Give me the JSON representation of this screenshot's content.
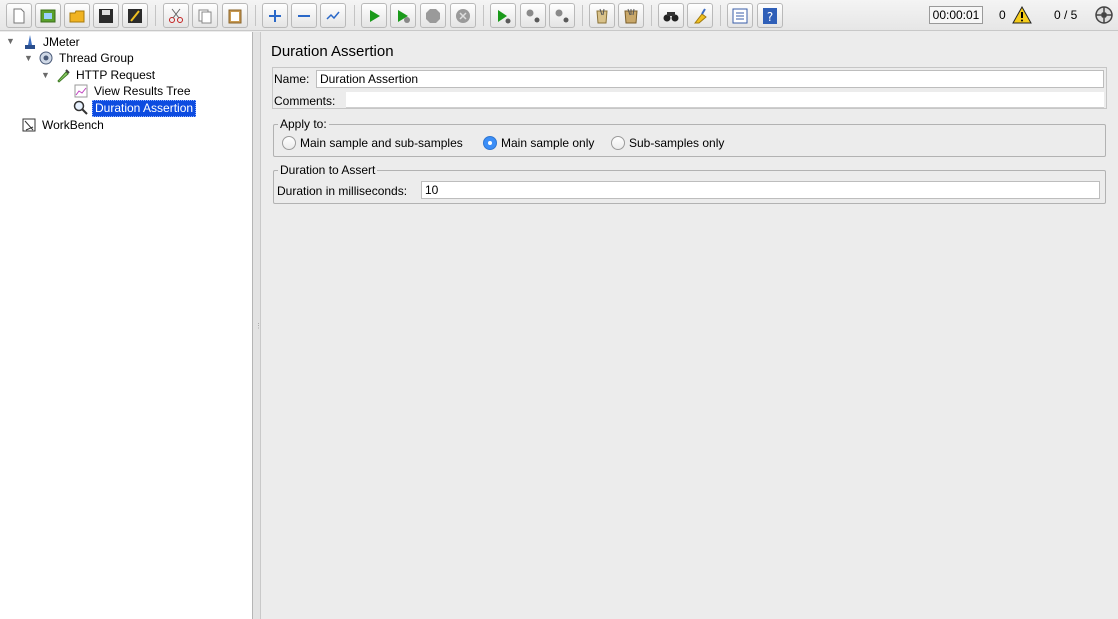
{
  "toolbar": {
    "buttons": [
      {
        "name": "new-icon"
      },
      {
        "name": "templates-icon"
      },
      {
        "name": "open-icon"
      },
      {
        "name": "save-icon"
      },
      {
        "name": "save-as-icon"
      },
      {
        "name": "cut-icon"
      },
      {
        "name": "copy-icon"
      },
      {
        "name": "paste-icon"
      },
      {
        "name": "expand-icon"
      },
      {
        "name": "collapse-icon"
      },
      {
        "name": "toggle-icon"
      },
      {
        "name": "start-icon"
      },
      {
        "name": "start-no-pause-icon"
      },
      {
        "name": "stop-icon"
      },
      {
        "name": "shutdown-icon"
      },
      {
        "name": "remote-start-icon"
      },
      {
        "name": "remote-stop-icon"
      },
      {
        "name": "remote-shutdown-icon"
      },
      {
        "name": "clear-icon"
      },
      {
        "name": "clear-all-icon"
      },
      {
        "name": "search-icon"
      },
      {
        "name": "reset-search-icon"
      },
      {
        "name": "function-helper-icon"
      },
      {
        "name": "help-icon"
      }
    ],
    "timer": "00:00:01",
    "error_count": "0",
    "thread_count": "0 / 5"
  },
  "tree": {
    "nodes": [
      {
        "label": "JMeter",
        "icon": "jmeter-icon"
      },
      {
        "label": "Thread Group",
        "icon": "gear-icon"
      },
      {
        "label": "HTTP Request",
        "icon": "pipette-icon"
      },
      {
        "label": "View Results Tree",
        "icon": "chart-icon"
      },
      {
        "label": "Duration Assertion",
        "icon": "magnifier-icon",
        "selected": true
      },
      {
        "label": "WorkBench",
        "icon": "workbench-icon"
      }
    ]
  },
  "panel": {
    "title": "Duration Assertion",
    "name_label": "Name:",
    "name_value": "Duration Assertion",
    "comments_label": "Comments:",
    "comments_value": "",
    "apply_to": {
      "legend": "Apply to:",
      "options": [
        "Main sample and sub-samples",
        "Main sample only",
        "Sub-samples only"
      ],
      "selected": "Main sample only"
    },
    "duration": {
      "legend": "Duration to Assert",
      "label": "Duration in milliseconds:",
      "value": "10"
    }
  },
  "colors": {
    "selection": "#0d4ce0",
    "radio_on": "#3b8ef7",
    "start_green": "#1a9a1a"
  }
}
